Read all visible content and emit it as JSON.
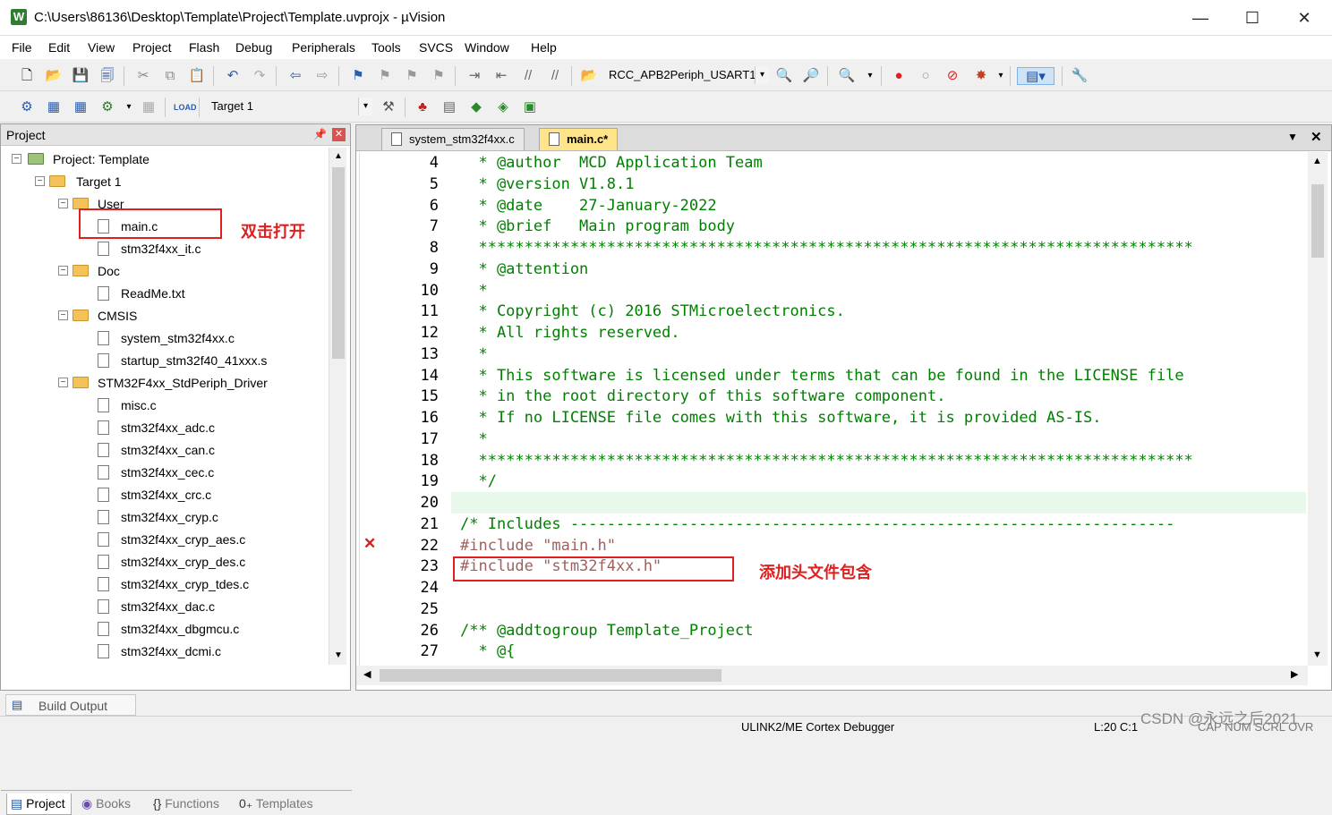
{
  "window": {
    "title": "C:\\Users\\86136\\Desktop\\Template\\Project\\Template.uvprojx - µVision",
    "app_icon": "W"
  },
  "menu": [
    "File",
    "Edit",
    "View",
    "Project",
    "Flash",
    "Debug",
    "Peripherals",
    "Tools",
    "SVCS",
    "Window",
    "Help"
  ],
  "toolbar1": {
    "combo_value": "RCC_APB2Periph_USART1"
  },
  "toolbar2": {
    "target_combo": "Target 1"
  },
  "project_panel": {
    "header": "Project",
    "tree": [
      {
        "label": "Project: Template",
        "kind": "root"
      },
      {
        "label": "Target 1",
        "kind": "target"
      },
      {
        "label": "User",
        "kind": "folder"
      },
      {
        "label": "main.c",
        "kind": "file"
      },
      {
        "label": "stm32f4xx_it.c",
        "kind": "file"
      },
      {
        "label": "Doc",
        "kind": "folder"
      },
      {
        "label": "ReadMe.txt",
        "kind": "file"
      },
      {
        "label": "CMSIS",
        "kind": "folder"
      },
      {
        "label": "system_stm32f4xx.c",
        "kind": "file"
      },
      {
        "label": "startup_stm32f40_41xxx.s",
        "kind": "file"
      },
      {
        "label": "STM32F4xx_StdPeriph_Driver",
        "kind": "folder"
      },
      {
        "label": "misc.c",
        "kind": "file"
      },
      {
        "label": "stm32f4xx_adc.c",
        "kind": "file"
      },
      {
        "label": "stm32f4xx_can.c",
        "kind": "file"
      },
      {
        "label": "stm32f4xx_cec.c",
        "kind": "file"
      },
      {
        "label": "stm32f4xx_crc.c",
        "kind": "file"
      },
      {
        "label": "stm32f4xx_cryp.c",
        "kind": "file"
      },
      {
        "label": "stm32f4xx_cryp_aes.c",
        "kind": "file"
      },
      {
        "label": "stm32f4xx_cryp_des.c",
        "kind": "file"
      },
      {
        "label": "stm32f4xx_cryp_tdes.c",
        "kind": "file"
      },
      {
        "label": "stm32f4xx_dac.c",
        "kind": "file"
      },
      {
        "label": "stm32f4xx_dbgmcu.c",
        "kind": "file"
      },
      {
        "label": "stm32f4xx_dcmi.c",
        "kind": "file"
      }
    ],
    "tabs": [
      "Project",
      "Books",
      "Functions",
      "Templates"
    ]
  },
  "annotations": {
    "open_note": "双击打开",
    "include_note": "添加头文件包含"
  },
  "editor": {
    "tabs": [
      "system_stm32f4xx.c",
      "main.c*"
    ],
    "lines": [
      {
        "n": "4",
        "text": "  * @author  MCD Application Team"
      },
      {
        "n": "5",
        "text": "  * @version V1.8.1"
      },
      {
        "n": "6",
        "text": "  * @date    27-January-2022"
      },
      {
        "n": "7",
        "text": "  * @brief   Main program body"
      },
      {
        "n": "8",
        "text": "  ******************************************************************************"
      },
      {
        "n": "9",
        "text": "  * @attention"
      },
      {
        "n": "10",
        "text": "  *"
      },
      {
        "n": "11",
        "text": "  * Copyright (c) 2016 STMicroelectronics."
      },
      {
        "n": "12",
        "text": "  * All rights reserved."
      },
      {
        "n": "13",
        "text": "  *"
      },
      {
        "n": "14",
        "text": "  * This software is licensed under terms that can be found in the LICENSE file"
      },
      {
        "n": "15",
        "text": "  * in the root directory of this software component."
      },
      {
        "n": "16",
        "text": "  * If no LICENSE file comes with this software, it is provided AS-IS."
      },
      {
        "n": "17",
        "text": "  *"
      },
      {
        "n": "18",
        "text": "  ******************************************************************************"
      },
      {
        "n": "19",
        "text": "  */"
      },
      {
        "n": "20",
        "text": ""
      },
      {
        "n": "21",
        "text": "/* Includes ------------------------------------------------------------------"
      },
      {
        "n": "22",
        "text": "#include \"main.h\""
      },
      {
        "n": "23",
        "text": "#include \"stm32f4xx.h\""
      },
      {
        "n": "24",
        "text": ""
      },
      {
        "n": "25",
        "text": ""
      },
      {
        "n": "26",
        "text": "/** @addtogroup Template_Project"
      },
      {
        "n": "27",
        "text": "  * @{"
      }
    ]
  },
  "build_output": "Build Output",
  "status": {
    "debugger": "ULINK2/ME Cortex Debugger",
    "position": "L:20 C:1",
    "indicators": "CAP  NUM  SCRL  OVR",
    "watermark": "CSDN @永远之后2021"
  },
  "colors": {
    "comment": "#008000",
    "annotation_red": "#e02020",
    "current_line": "#e8f9ec"
  }
}
